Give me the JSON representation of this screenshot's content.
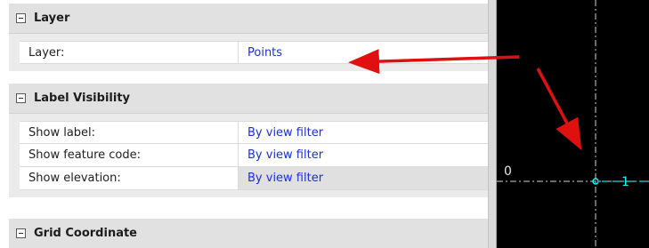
{
  "sections": {
    "layer": {
      "title": "Layer",
      "rows": [
        {
          "label": "Layer:",
          "value": "Points"
        }
      ]
    },
    "label_visibility": {
      "title": "Label Visibility",
      "rows": [
        {
          "label": "Show label:",
          "value": "By view filter"
        },
        {
          "label": "Show feature code:",
          "value": "By view filter"
        },
        {
          "label": "Show elevation:",
          "value": "By view filter"
        }
      ]
    },
    "grid_coordinate": {
      "title": "Grid Coordinate"
    }
  },
  "canvas": {
    "axis_label_zero": "0",
    "point_label": "1",
    "background_color": "#000000",
    "point_color": "#00ffff"
  },
  "colors": {
    "value_text": "#1a2fd6",
    "annotation_arrow": "#e01010",
    "section_header": "#e1e1e1"
  }
}
